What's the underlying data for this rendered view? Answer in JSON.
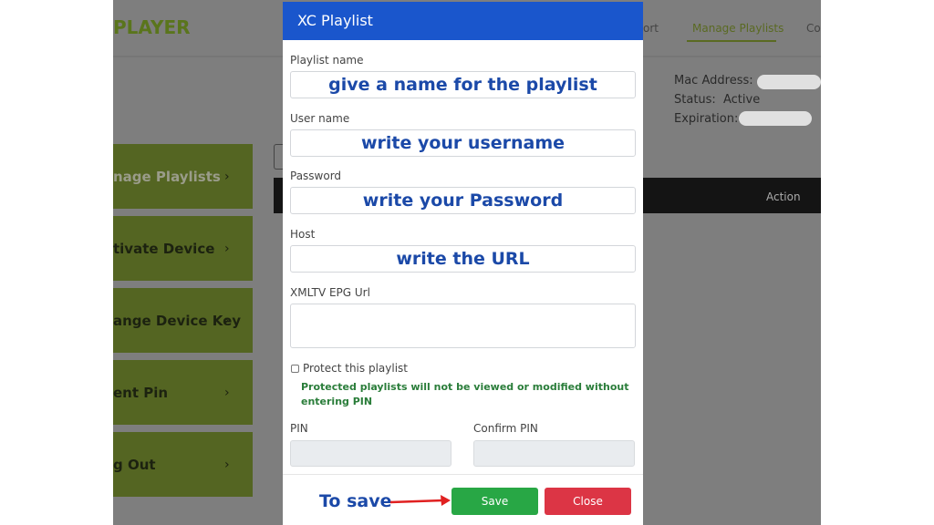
{
  "background": {
    "logo": "PLAYER",
    "nav": [
      {
        "label": "ort"
      },
      {
        "label": "Manage Playlists",
        "active": true
      },
      {
        "label": "Co"
      }
    ],
    "device": {
      "mac_label": "Mac Address:",
      "status_label": "Status:",
      "status_value": "Active",
      "expiration_label": "Expiration:"
    },
    "sidebar": [
      {
        "label": "nage Playlists"
      },
      {
        "label": "tivate Device"
      },
      {
        "label": "ange Device Key"
      },
      {
        "label": "ent Pin"
      },
      {
        "label": "g Out"
      }
    ],
    "table": {
      "action_header": "Action"
    },
    "accent": "#546522"
  },
  "modal": {
    "title": "XC Playlist",
    "fields": [
      {
        "label": "Playlist name",
        "value": "give a name for the playlist"
      },
      {
        "label": "User name",
        "value": "write your username"
      },
      {
        "label": "Password",
        "value": "write your Password"
      },
      {
        "label": "Host",
        "value": "write the URL"
      },
      {
        "label": "XMLTV EPG Url",
        "value": ""
      }
    ],
    "protect_label": "Protect this playlist",
    "protect_checked": false,
    "protect_note": "Protected playlists will not be viewed or modified without entering PIN",
    "pin_label": "PIN",
    "confirm_pin_label": "Confirm PIN",
    "save_label": "Save",
    "close_label": "Close",
    "annotation": "To save",
    "colors": {
      "header": "#1a56cc",
      "save": "#28a745",
      "close": "#dc3545",
      "annotation": "#1b49a8"
    }
  }
}
